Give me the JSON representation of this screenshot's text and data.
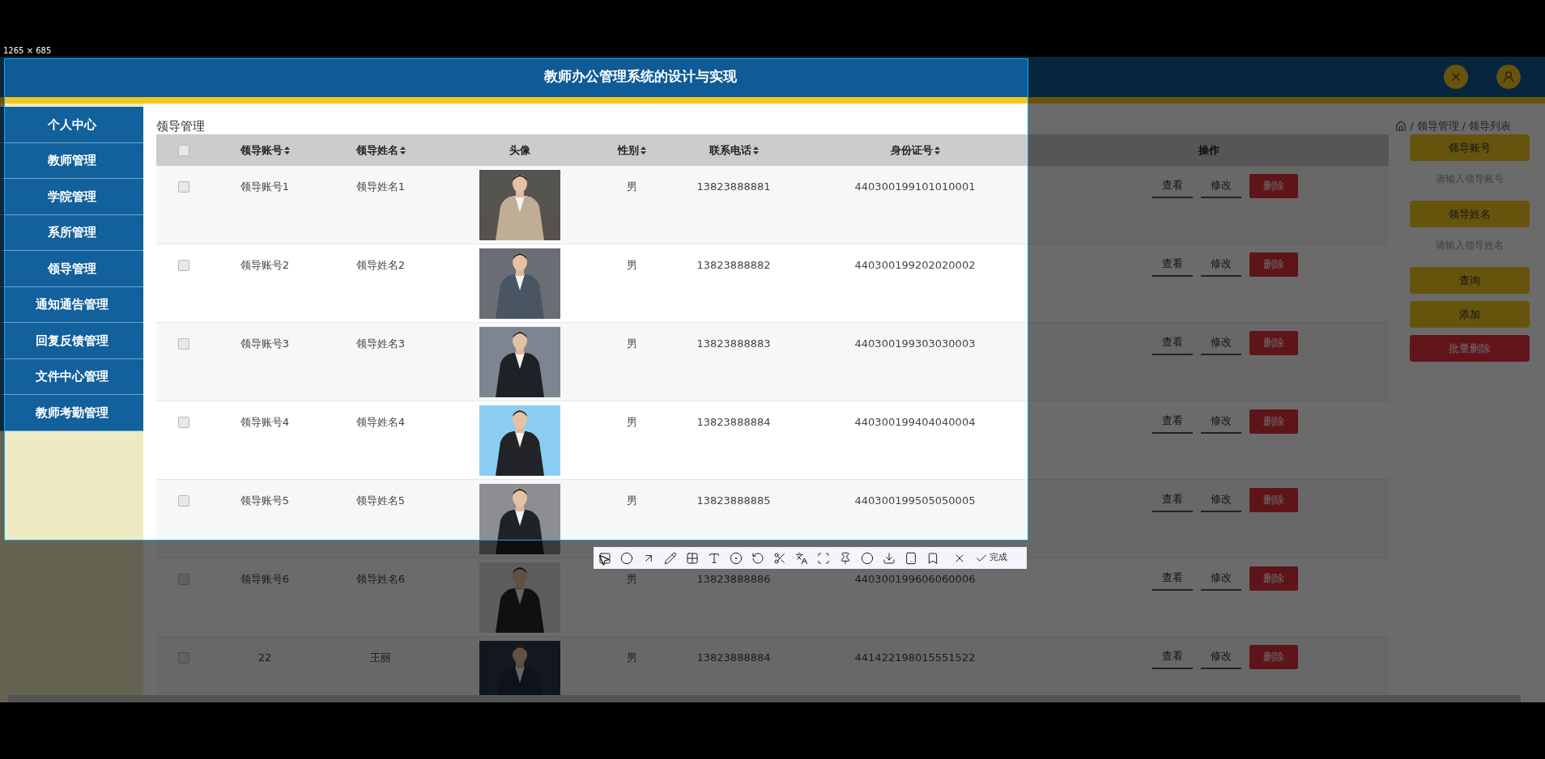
{
  "capture": {
    "size_label": "1265 × 685",
    "confirm": "完成"
  },
  "header": {
    "title": "教师办公管理系统的设计与实现"
  },
  "sidebar": {
    "items": [
      {
        "label": "个人中心"
      },
      {
        "label": "教师管理"
      },
      {
        "label": "学院管理"
      },
      {
        "label": "系所管理"
      },
      {
        "label": "领导管理"
      },
      {
        "label": "通知通告管理"
      },
      {
        "label": "回复反馈管理"
      },
      {
        "label": "文件中心管理"
      },
      {
        "label": "教师考勤管理"
      }
    ]
  },
  "page_title": "领导管理",
  "breadcrumb": {
    "separator": "/",
    "items": [
      "领导管理",
      "领导列表"
    ]
  },
  "table": {
    "select_all_checked": false,
    "columns": [
      {
        "label": "领导账号",
        "sortable": true
      },
      {
        "label": "领导姓名",
        "sortable": true
      },
      {
        "label": "头像",
        "sortable": false
      },
      {
        "label": "性别",
        "sortable": true
      },
      {
        "label": "联系电话",
        "sortable": true
      },
      {
        "label": "身份证号",
        "sortable": true
      },
      {
        "label": "操作",
        "sortable": false
      }
    ],
    "rows": [
      {
        "checked": false,
        "account": "领导账号1",
        "name": "领导姓名1",
        "gender": "男",
        "phone": "13823888881",
        "id_number": "440300199101010001",
        "actions": [
          {
            "label": "查看",
            "kind": "link"
          },
          {
            "label": "修改",
            "kind": "link"
          },
          {
            "label": "删除",
            "kind": "danger"
          }
        ]
      },
      {
        "checked": false,
        "account": "领导账号2",
        "name": "领导姓名2",
        "gender": "男",
        "phone": "13823888882",
        "id_number": "440300199202020002",
        "actions": [
          {
            "label": "查看",
            "kind": "link"
          },
          {
            "label": "修改",
            "kind": "link"
          },
          {
            "label": "删除",
            "kind": "danger"
          }
        ]
      },
      {
        "checked": false,
        "account": "领导账号3",
        "name": "领导姓名3",
        "gender": "男",
        "phone": "13823888883",
        "id_number": "440300199303030003",
        "actions": [
          {
            "label": "查看",
            "kind": "link"
          },
          {
            "label": "修改",
            "kind": "link"
          },
          {
            "label": "删除",
            "kind": "danger"
          }
        ]
      },
      {
        "checked": false,
        "account": "领导账号4",
        "name": "领导姓名4",
        "gender": "男",
        "phone": "13823888884",
        "id_number": "440300199404040004",
        "actions": [
          {
            "label": "查看",
            "kind": "link"
          },
          {
            "label": "修改",
            "kind": "link"
          },
          {
            "label": "删除",
            "kind": "danger"
          }
        ]
      },
      {
        "checked": false,
        "account": "领导账号5",
        "name": "领导姓名5",
        "gender": "男",
        "phone": "13823888885",
        "id_number": "440300199505050005",
        "actions": [
          {
            "label": "查看",
            "kind": "link"
          },
          {
            "label": "修改",
            "kind": "link"
          },
          {
            "label": "删除",
            "kind": "danger"
          }
        ]
      },
      {
        "checked": false,
        "account": "领导账号6",
        "name": "领导姓名6",
        "gender": "男",
        "phone": "13823888886",
        "id_number": "440300199606060006",
        "actions": [
          {
            "label": "查看",
            "kind": "link"
          },
          {
            "label": "修改",
            "kind": "link"
          },
          {
            "label": "删除",
            "kind": "danger"
          }
        ]
      },
      {
        "checked": false,
        "account": "22",
        "name": "王丽",
        "gender": "男",
        "phone": "13823888884",
        "id_number": "441422198015551522",
        "actions": [
          {
            "label": "查看",
            "kind": "link"
          },
          {
            "label": "修改",
            "kind": "link"
          },
          {
            "label": "删除",
            "kind": "danger"
          }
        ]
      }
    ]
  },
  "search": {
    "fields": [
      {
        "label": "领导账号",
        "placeholder": "请输入领导账号"
      },
      {
        "label": "领导姓名",
        "placeholder": "请输入领导姓名"
      }
    ],
    "buttons": [
      {
        "label": "查询",
        "kind": "primary"
      },
      {
        "label": "添加",
        "kind": "primary"
      },
      {
        "label": "批量删除",
        "kind": "danger"
      }
    ]
  }
}
